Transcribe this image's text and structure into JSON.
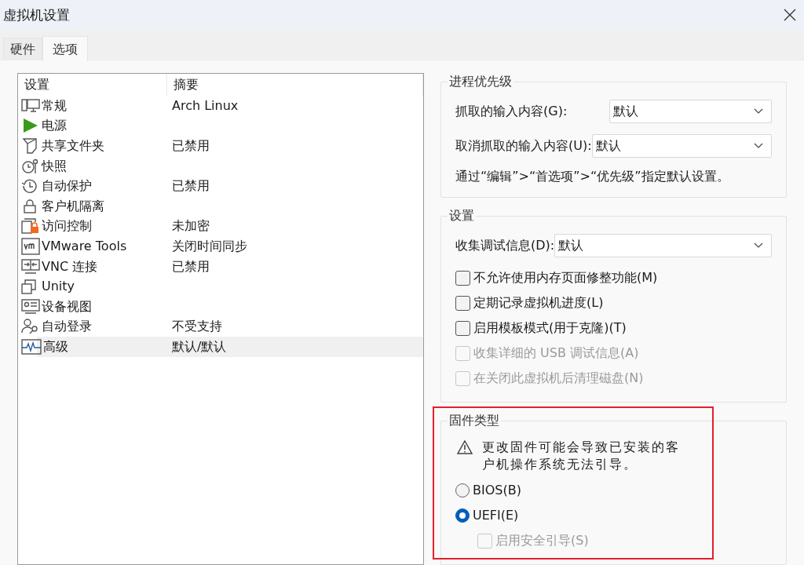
{
  "window": {
    "title": "虚拟机设置"
  },
  "tabs": [
    {
      "label": "硬件",
      "selected": false
    },
    {
      "label": "选项",
      "selected": true
    }
  ],
  "settings_list": {
    "columns": [
      "设置",
      "摘要"
    ],
    "rows": [
      {
        "name": "常规",
        "summary": "Arch Linux",
        "selected": false
      },
      {
        "name": "电源",
        "selected": false
      },
      {
        "name": "共享文件夹",
        "summary": "已禁用",
        "selected": false
      },
      {
        "name": "快照",
        "selected": false
      },
      {
        "name": "自动保护",
        "summary": "已禁用",
        "selected": false
      },
      {
        "name": "客户机隔离",
        "selected": false
      },
      {
        "name": "访问控制",
        "summary": "未加密",
        "selected": false
      },
      {
        "name": "VMware Tools",
        "summary": "关闭时间同步",
        "selected": false
      },
      {
        "name": "VNC 连接",
        "summary": "已禁用",
        "selected": false
      },
      {
        "name": "Unity",
        "selected": false
      },
      {
        "name": "设备视图",
        "selected": false
      },
      {
        "name": "自动登录",
        "summary": "不受支持",
        "selected": false
      },
      {
        "name": "高级",
        "summary": "默认/默认",
        "selected": true
      }
    ]
  },
  "priority": {
    "title": "进程优先级",
    "fields": [
      {
        "label": "抓取的输入内容(G):",
        "value": "默认"
      },
      {
        "label": "取消抓取的输入内容(U):",
        "value": "默认"
      }
    ],
    "note": "通过“编辑”>“首选项”>“优先级”指定默认设置。"
  },
  "options": {
    "title": "设置",
    "field": {
      "label": "收集调试信息(D):",
      "value": "默认"
    },
    "checkboxes": [
      {
        "label": "不允许使用内存页面修整功能(M)",
        "checked": false,
        "disabled": false
      },
      {
        "label": "定期记录虚拟机进度(L)",
        "checked": false,
        "disabled": false
      },
      {
        "label": "启用模板模式(用于克隆)(T)",
        "checked": false,
        "disabled": false
      },
      {
        "label": "收集详细的 USB 调试信息(A)",
        "checked": false,
        "disabled": true
      },
      {
        "label": "在关闭此虚拟机后清理磁盘(N)",
        "checked": false,
        "disabled": true
      }
    ]
  },
  "firmware": {
    "title": "固件类型",
    "warning": "更改固件可能会导致已安装的客户机操作系统无法引导。",
    "options": [
      {
        "label": "BIOS(B)",
        "selected": false
      },
      {
        "label": "UEFI(E)",
        "selected": true
      }
    ],
    "secure_boot": {
      "label": "启用安全引导(S)",
      "checked": false,
      "disabled": true
    }
  }
}
